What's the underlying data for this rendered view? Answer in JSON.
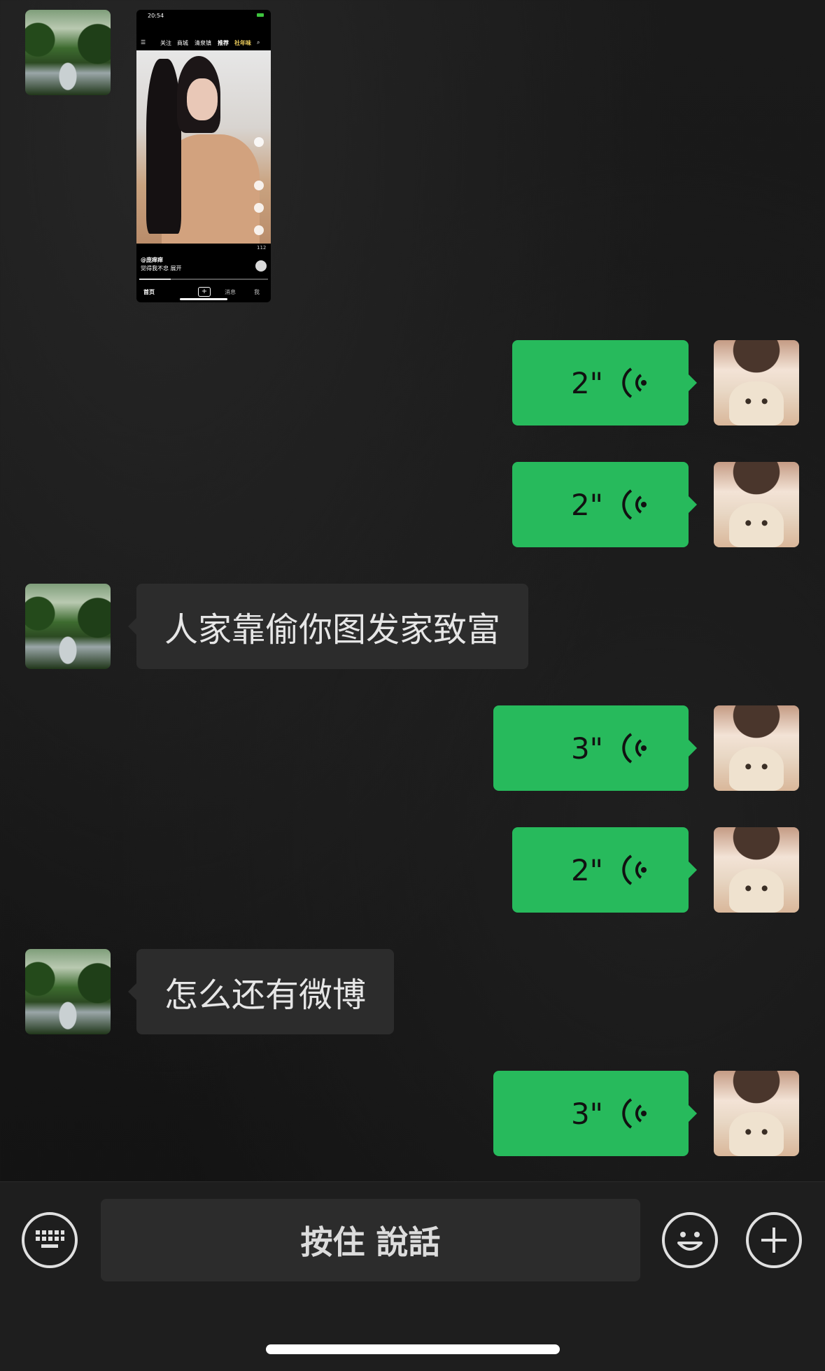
{
  "shared_screenshot": {
    "status_time": "20:54",
    "top_tabs": [
      "关注",
      "商城",
      "清泉镇",
      "推荐",
      "社年味"
    ],
    "author": "@庞痒痒",
    "caption": "觉得我不忠",
    "caption_more": "展开",
    "share_count": "112",
    "bottom_nav": [
      "首页",
      "+",
      "消息",
      "我"
    ]
  },
  "messages": [
    {
      "side": "right",
      "type": "voice",
      "duration": "2\""
    },
    {
      "side": "right",
      "type": "voice",
      "duration": "2\""
    },
    {
      "side": "left",
      "type": "text",
      "text": "人家靠偷你图发家致富"
    },
    {
      "side": "right",
      "type": "voice",
      "duration": "3\""
    },
    {
      "side": "right",
      "type": "voice",
      "duration": "2\""
    },
    {
      "side": "left",
      "type": "text",
      "text": "怎么还有微博"
    },
    {
      "side": "right",
      "type": "voice",
      "duration": "3\""
    }
  ],
  "input_bar": {
    "hold_to_talk_label": "按住 說話",
    "icons": [
      "keyboard-icon",
      "emoji-icon",
      "plus-icon"
    ]
  },
  "colors": {
    "sent_bubble": "#27ba5c",
    "received_bubble": "#2c2c2c",
    "background": "#151515"
  }
}
